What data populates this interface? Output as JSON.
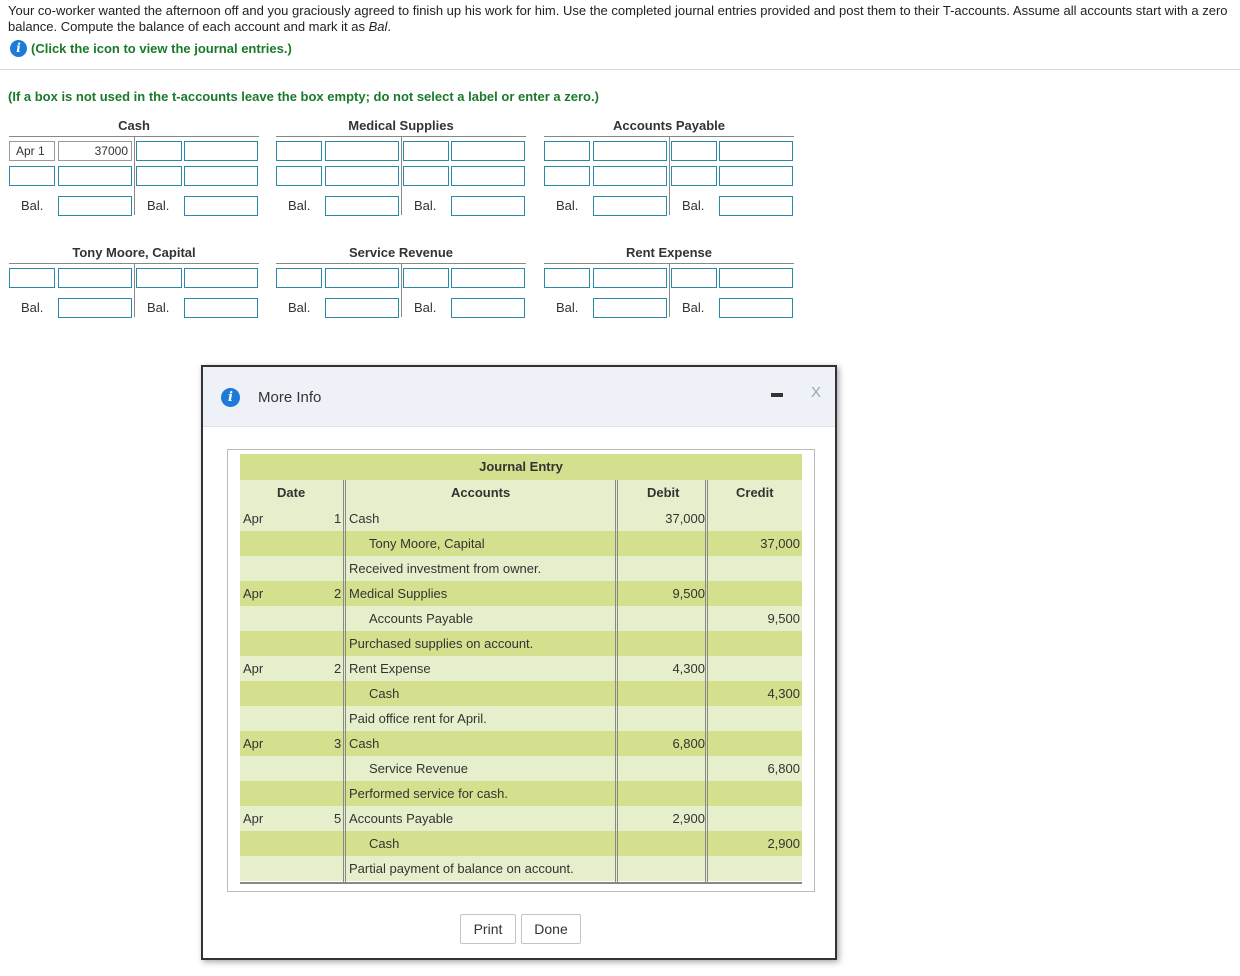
{
  "intro": {
    "text": "Your co-worker wanted the afternoon off and you graciously agreed to finish up his work for him. Use the completed journal entries provided and post them to their T-accounts. Assume all accounts start with a zero balance. Compute the balance of each account and mark it as ",
    "bal_word": "Bal",
    "end": "."
  },
  "info_link": {
    "icon": "info-icon",
    "text": "(Click the icon to view the journal entries.)"
  },
  "note": "(If a box is not used in the t-accounts leave the box empty; do not select a label or enter a zero.)",
  "bal_label": "Bal.",
  "t_accounts": [
    {
      "title": "Cash",
      "row1_label": "Apr 1",
      "row1_value": "37000"
    },
    {
      "title": "Medical Supplies"
    },
    {
      "title": "Accounts Payable"
    },
    {
      "title": "Tony Moore, Capital"
    },
    {
      "title": "Service Revenue"
    },
    {
      "title": "Rent Expense"
    }
  ],
  "modal": {
    "icon": "info-icon",
    "title": "More Info",
    "minimize_icon": "minimize-icon",
    "close_label": "X",
    "table": {
      "title": "Journal Entry",
      "headers": {
        "date": "Date",
        "accounts": "Accounts",
        "debit": "Debit",
        "credit": "Credit"
      },
      "rows": [
        {
          "month": "Apr",
          "day": "1",
          "account": "Cash",
          "debit": "37,000",
          "credit": ""
        },
        {
          "month": "",
          "day": "",
          "account": "Tony Moore, Capital",
          "debit": "",
          "credit": "37,000"
        },
        {
          "month": "",
          "day": "",
          "account": "Received investment from owner.",
          "debit": "",
          "credit": ""
        },
        {
          "month": "Apr",
          "day": "2",
          "account": "Medical Supplies",
          "debit": "9,500",
          "credit": ""
        },
        {
          "month": "",
          "day": "",
          "account": "Accounts Payable",
          "debit": "",
          "credit": "9,500"
        },
        {
          "month": "",
          "day": "",
          "account": "Purchased supplies on account.",
          "debit": "",
          "credit": ""
        },
        {
          "month": "Apr",
          "day": "2",
          "account": "Rent Expense",
          "debit": "4,300",
          "credit": ""
        },
        {
          "month": "",
          "day": "",
          "account": "Cash",
          "debit": "",
          "credit": "4,300"
        },
        {
          "month": "",
          "day": "",
          "account": "Paid office rent for April.",
          "debit": "",
          "credit": ""
        },
        {
          "month": "Apr",
          "day": "3",
          "account": "Cash",
          "debit": "6,800",
          "credit": ""
        },
        {
          "month": "",
          "day": "",
          "account": "Service Revenue",
          "debit": "",
          "credit": "6,800"
        },
        {
          "month": "",
          "day": "",
          "account": "Performed service for cash.",
          "debit": "",
          "credit": ""
        },
        {
          "month": "Apr",
          "day": "5",
          "account": "Accounts Payable",
          "debit": "2,900",
          "credit": ""
        },
        {
          "month": "",
          "day": "",
          "account": "Cash",
          "debit": "",
          "credit": "2,900"
        },
        {
          "month": "",
          "day": "",
          "account": "Partial payment of balance on account.",
          "debit": "",
          "credit": ""
        }
      ]
    },
    "buttons": {
      "print": "Print",
      "done": "Done"
    }
  }
}
